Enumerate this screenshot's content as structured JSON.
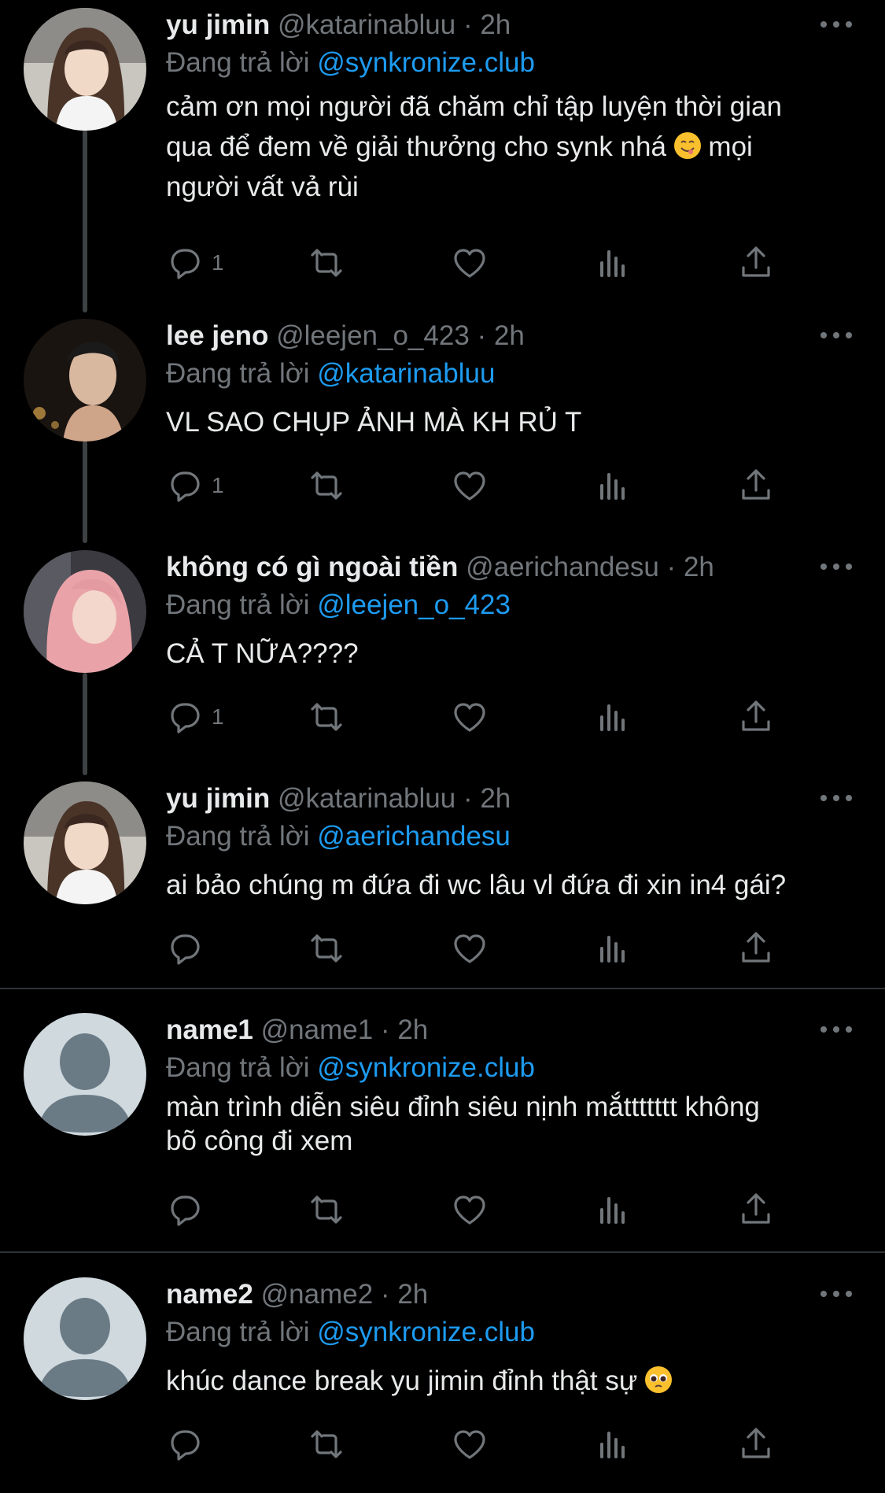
{
  "reply_prefix": "Đang trả lời",
  "colors": {
    "background": "#000000",
    "text": "#e7e9ea",
    "muted": "#71767b",
    "link": "#1d9bf0"
  },
  "icons": [
    "reply-icon",
    "retweet-icon",
    "like-icon",
    "views-icon",
    "share-icon",
    "more-icon"
  ],
  "tweets": [
    {
      "name": "yu jimin",
      "handle": "@katarinabluu",
      "time": "2h",
      "reply_to": "@synkronize.club",
      "text_lines": [
        "cảm ơn mọi người đã chăm chỉ tập luyện thời gian",
        "qua để đem về giải thưởng cho synk nhá",
        "mọi",
        "người vất vả rùi"
      ],
      "reply_count": "1",
      "emoji": "yum-emoji"
    },
    {
      "name": "lee jeno",
      "handle": "@leejen_o_423",
      "time": "2h",
      "reply_to": "@katarinabluu",
      "text": "VL SAO CHỤP ẢNH MÀ KH RỦ T",
      "reply_count": "1"
    },
    {
      "name": "không có gì ngoài tiền",
      "handle": "@aerichandesu",
      "time": "2h",
      "reply_to": "@leejen_o_423",
      "text": "CẢ T NỮA????",
      "reply_count": "1"
    },
    {
      "name": "yu jimin",
      "handle": "@katarinabluu",
      "time": "2h",
      "reply_to": "@aerichandesu",
      "text": "ai bảo chúng m đứa đi wc lâu vl đứa đi xin in4 gái?",
      "reply_count": ""
    },
    {
      "name": "name1",
      "handle": "@name1",
      "time": "2h",
      "reply_to": "@synkronize.club",
      "text_lines": [
        "màn trình diễn siêu đỉnh siêu nịnh mắttttttt không",
        "bõ công đi xem"
      ],
      "reply_count": ""
    },
    {
      "name": "name2",
      "handle": "@name2",
      "time": "2h",
      "reply_to": "@synkronize.club",
      "text": "khúc dance break yu jimin đỉnh thật sự",
      "reply_count": "",
      "emoji": "pleading-face-emoji"
    }
  ]
}
